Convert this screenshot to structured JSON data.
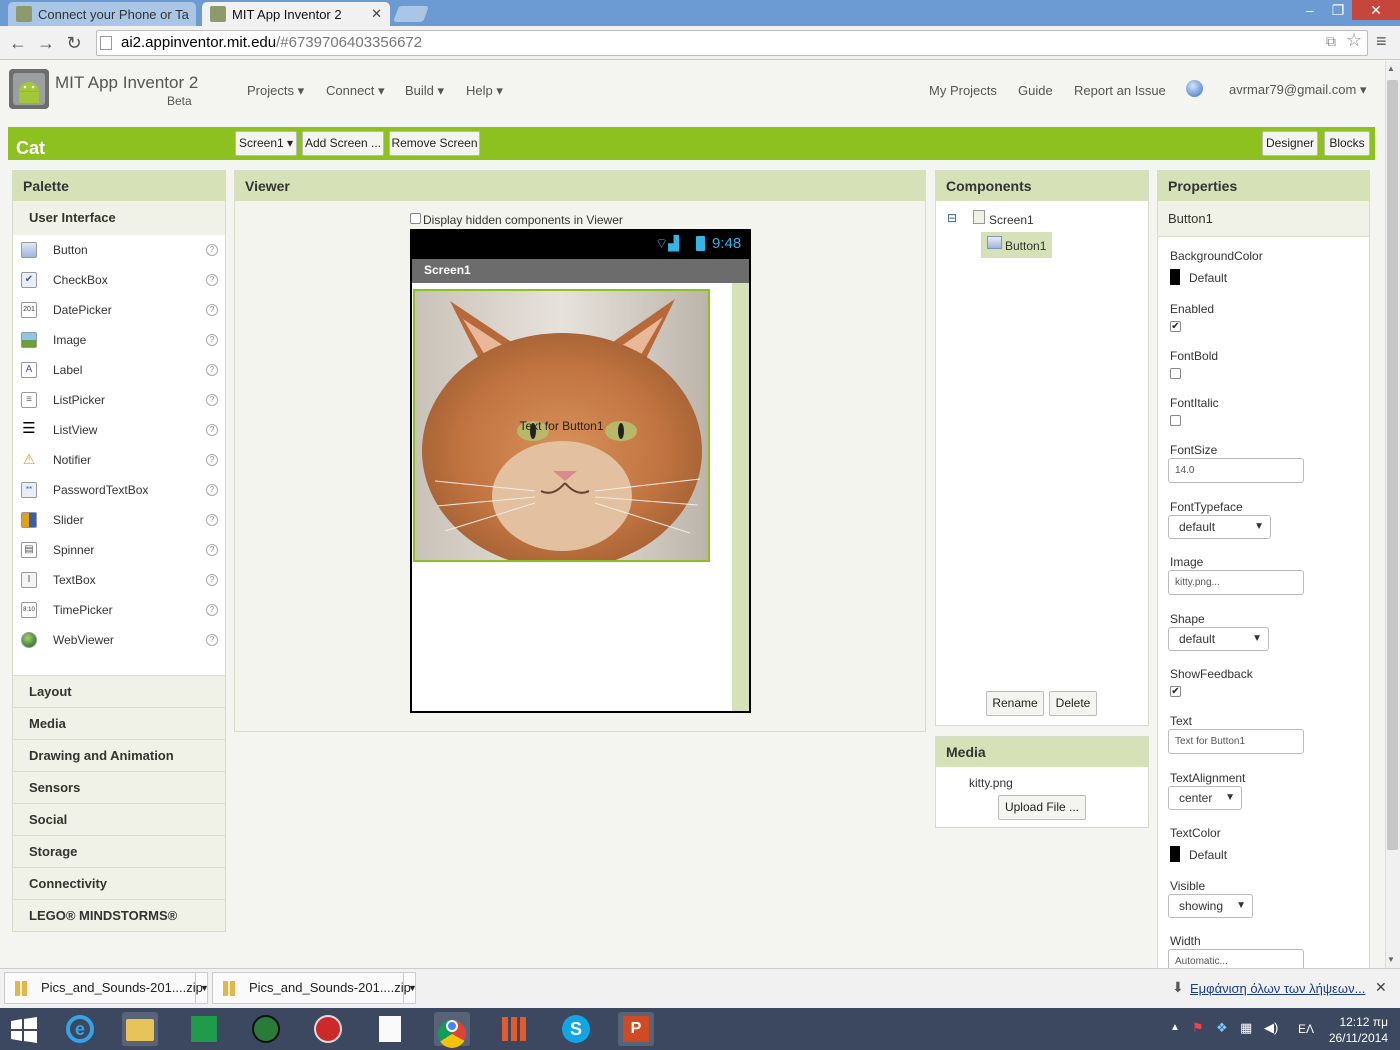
{
  "browser": {
    "tabs": [
      {
        "label": "Connect your Phone or Ta",
        "active": false
      },
      {
        "label": "MIT App Inventor 2",
        "active": true
      }
    ],
    "url_host": "ai2.appinventor.mit.edu",
    "url_path": "/#6739706403356672",
    "window_buttons": [
      "‒",
      "❐",
      "✕"
    ]
  },
  "header": {
    "title": "MIT App Inventor 2",
    "subtitle": "Beta",
    "menus": [
      "Projects ▾",
      "Connect ▾",
      "Build ▾",
      "Help ▾"
    ],
    "links": {
      "my_projects": "My Projects",
      "guide": "Guide",
      "report": "Report an Issue",
      "account": "avrmar79@gmail.com ▾"
    }
  },
  "project_bar": {
    "project_name": "Cat",
    "screen_select": "Screen1 ▾",
    "add_screen": "Add Screen ...",
    "remove_screen": "Remove Screen",
    "designer": "Designer",
    "blocks": "Blocks"
  },
  "palette": {
    "title": "Palette",
    "open_drawer": "User Interface",
    "items": [
      {
        "label": "Button",
        "icon": "button-icon",
        "glyph": ""
      },
      {
        "label": "CheckBox",
        "icon": "checkbox-icon",
        "glyph": "✔"
      },
      {
        "label": "DatePicker",
        "icon": "datepicker-icon",
        "glyph": "201"
      },
      {
        "label": "Image",
        "icon": "image-icon",
        "glyph": ""
      },
      {
        "label": "Label",
        "icon": "label-icon",
        "glyph": "A"
      },
      {
        "label": "ListPicker",
        "icon": "listpicker-icon",
        "glyph": "≡"
      },
      {
        "label": "ListView",
        "icon": "listview-icon",
        "glyph": "☰"
      },
      {
        "label": "Notifier",
        "icon": "notifier-icon",
        "glyph": "⚠"
      },
      {
        "label": "PasswordTextBox",
        "icon": "password-icon",
        "glyph": "**"
      },
      {
        "label": "Slider",
        "icon": "slider-icon",
        "glyph": "▮"
      },
      {
        "label": "Spinner",
        "icon": "spinner-icon",
        "glyph": "▤"
      },
      {
        "label": "TextBox",
        "icon": "textbox-icon",
        "glyph": "I"
      },
      {
        "label": "TimePicker",
        "icon": "timepicker-icon",
        "glyph": "8:10"
      },
      {
        "label": "WebViewer",
        "icon": "webviewer-icon",
        "glyph": "●"
      }
    ],
    "drawers": [
      "Layout",
      "Media",
      "Drawing and Animation",
      "Sensors",
      "Social",
      "Storage",
      "Connectivity",
      "LEGO® MINDSTORMS®"
    ],
    "help_glyph": "?"
  },
  "viewer": {
    "title": "Viewer",
    "hidden_checkbox_label": "Display hidden components in Viewer",
    "phone_time": "9:48",
    "screen_title": "Screen1",
    "button_text": "Text for Button1"
  },
  "components": {
    "title": "Components",
    "tree": {
      "root": "Screen1",
      "child": "Button1",
      "collapse_glyph": "⊟"
    },
    "rename": "Rename",
    "delete": "Delete"
  },
  "media": {
    "title": "Media",
    "file": "kitty.png",
    "upload": "Upload File ..."
  },
  "properties": {
    "title": "Properties",
    "component": "Button1",
    "background_color_label": "BackgroundColor",
    "background_color_value": "Default",
    "enabled_label": "Enabled",
    "enabled": true,
    "fontbold_label": "FontBold",
    "fontbold": false,
    "fontitalic_label": "FontItalic",
    "fontitalic": false,
    "fontsize_label": "FontSize",
    "fontsize_value": "14.0",
    "fonttypeface_label": "FontTypeface",
    "fonttypeface_value": "default",
    "image_label": "Image",
    "image_value": "kitty.png...",
    "shape_label": "Shape",
    "shape_value": "default",
    "showfeedback_label": "ShowFeedback",
    "showfeedback": true,
    "text_label": "Text",
    "text_value": "Text for Button1",
    "textalignment_label": "TextAlignment",
    "textalignment_value": "center",
    "textcolor_label": "TextColor",
    "textcolor_value": "Default",
    "visible_label": "Visible",
    "visible_value": "showing",
    "width_label": "Width",
    "width_value": "Automatic..."
  },
  "downloads": {
    "items": [
      "Pics_and_Sounds-201....zip",
      "Pics_and_Sounds-201....zip"
    ],
    "show_all": "Εμφάνιση όλων των λήψεων..."
  },
  "taskbar": {
    "time": "12:12 πμ",
    "date": "26/11/2014",
    "lang": "ΕΛ"
  },
  "colors": {
    "accent_green": "#8cc11f",
    "panel_header": "#d6e1b8"
  }
}
